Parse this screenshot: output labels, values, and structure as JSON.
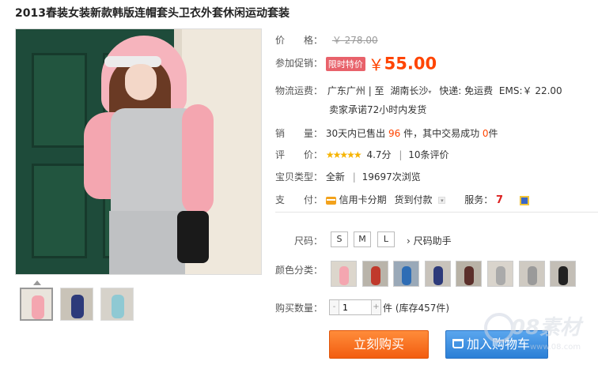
{
  "product": {
    "title": "2013春装女装新款韩版连帽套头卫衣外套休闲运动套装"
  },
  "price": {
    "label": "价　　格：",
    "original": "￥ 278.00",
    "promo_label": "参加促销：",
    "promo_badge": "限时特价",
    "currency": "￥",
    "promo_price": "55.00"
  },
  "shipping": {
    "label": "物流运费：",
    "from": "广东广州",
    "separator": "| 至",
    "to": "湖南长沙",
    "express": "快递: 免运费",
    "ems": "EMS:￥ 22.00",
    "promise": "卖家承诺72小时内发货"
  },
  "sales": {
    "label": "销　　量：",
    "prefix": "30天内已售出",
    "sold": "96",
    "middle": "件，其中交易成功",
    "success": "0",
    "suffix": "件"
  },
  "rating": {
    "label": "评　　价：",
    "stars": "★★★★★",
    "score": "4.7分",
    "separator": "|",
    "reviews": "10条评价"
  },
  "item_type": {
    "label": "宝贝类型：",
    "value": "全新",
    "separator": "|",
    "views": "19697次浏览"
  },
  "payment": {
    "label": "支　　付：",
    "credit": "信用卡分期",
    "cod": "货到付款",
    "service_label": "服务："
  },
  "size": {
    "label": "尺码：",
    "options": [
      "S",
      "M",
      "L"
    ],
    "helper": "› 尺码助手"
  },
  "color": {
    "label": "颜色分类：",
    "swatches": [
      {
        "bg": "#dcd6cc",
        "fig": "#f4a6b0"
      },
      {
        "bg": "#b9b4aa",
        "fig": "#c0392b"
      },
      {
        "bg": "#9aa9b8",
        "fig": "#2e6db5"
      },
      {
        "bg": "#c8c3bb",
        "fig": "#2d3a7a"
      },
      {
        "bg": "#b8b2a6",
        "fig": "#5b2f2a"
      },
      {
        "bg": "#d9d4cc",
        "fig": "#aaaaaa"
      },
      {
        "bg": "#cfcac2",
        "fig": "#9a9a9a"
      },
      {
        "bg": "#c3beb6",
        "fig": "#222222"
      }
    ]
  },
  "quantity": {
    "label": "购买数量：",
    "minus": "-",
    "value": "1",
    "plus": "+",
    "stock": "件 (库存457件)"
  },
  "actions": {
    "buy_now": "立刻购买",
    "add_cart": "加入购物车"
  },
  "thumbnails": [
    {
      "bg": "#e9e4dc",
      "fig": "#f4a6b0"
    },
    {
      "bg": "#c9c3b8",
      "fig": "#2d3a7a"
    },
    {
      "bg": "#d6d2ca",
      "fig": "#8fc9d3"
    }
  ],
  "watermark": {
    "text": "08素材",
    "url": "www.08.com"
  }
}
